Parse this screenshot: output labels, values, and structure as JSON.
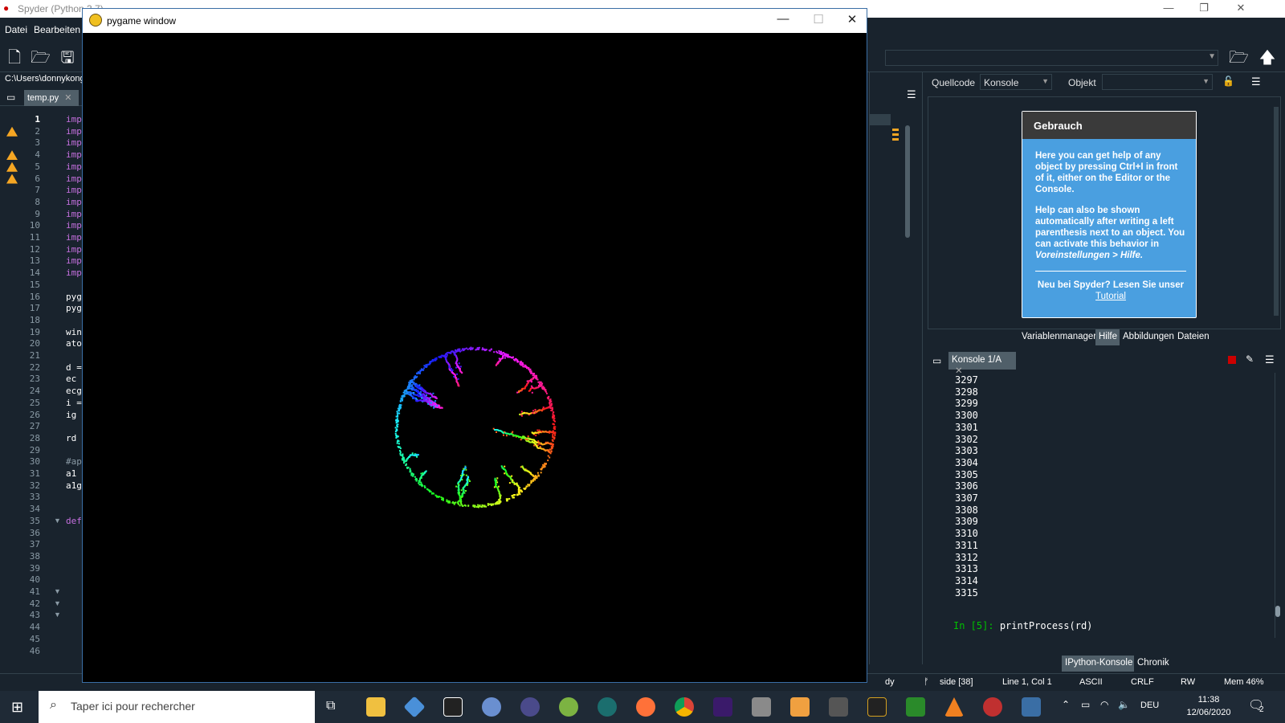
{
  "spyder": {
    "title": "Spyder (Python 3.7)",
    "menu": [
      "Datei",
      "Bearbeiten"
    ],
    "path": "C:\\Users\\donnykong",
    "editor_tab": "temp.py",
    "code_lines": [
      {
        "n": "1",
        "t": "imp"
      },
      {
        "n": "2",
        "t": "imp"
      },
      {
        "n": "3",
        "t": "imp"
      },
      {
        "n": "4",
        "t": "imp"
      },
      {
        "n": "5",
        "t": "imp"
      },
      {
        "n": "6",
        "t": "imp"
      },
      {
        "n": "7",
        "t": "imp"
      },
      {
        "n": "8",
        "t": "imp"
      },
      {
        "n": "9",
        "t": "imp"
      },
      {
        "n": "10",
        "t": "imp"
      },
      {
        "n": "11",
        "t": "imp"
      },
      {
        "n": "12",
        "t": "imp"
      },
      {
        "n": "13",
        "t": "imp"
      },
      {
        "n": "14",
        "t": "imp"
      },
      {
        "n": "15",
        "t": ""
      },
      {
        "n": "16",
        "t": "pyg"
      },
      {
        "n": "17",
        "t": "pyg"
      },
      {
        "n": "18",
        "t": ""
      },
      {
        "n": "19",
        "t": "win"
      },
      {
        "n": "20",
        "t": "ato"
      },
      {
        "n": "21",
        "t": ""
      },
      {
        "n": "22",
        "t": "d ="
      },
      {
        "n": "23",
        "t": "ec"
      },
      {
        "n": "24",
        "t": "ecg"
      },
      {
        "n": "25",
        "t": "i ="
      },
      {
        "n": "26",
        "t": "ig"
      },
      {
        "n": "27",
        "t": ""
      },
      {
        "n": "28",
        "t": "rd"
      },
      {
        "n": "29",
        "t": ""
      },
      {
        "n": "30",
        "t": "#ap"
      },
      {
        "n": "31",
        "t": "a1"
      },
      {
        "n": "32",
        "t": "a1g"
      },
      {
        "n": "33",
        "t": ""
      },
      {
        "n": "34",
        "t": ""
      },
      {
        "n": "35",
        "t": "def"
      },
      {
        "n": "36",
        "t": ""
      },
      {
        "n": "37",
        "t": ""
      },
      {
        "n": "38",
        "t": ""
      },
      {
        "n": "39",
        "t": ""
      },
      {
        "n": "40",
        "t": ""
      },
      {
        "n": "41",
        "t": ""
      },
      {
        "n": "42",
        "t": ""
      },
      {
        "n": "43",
        "t": ""
      },
      {
        "n": "44",
        "t": ""
      },
      {
        "n": "45",
        "t": ""
      },
      {
        "n": "46",
        "t": ""
      }
    ],
    "help": {
      "source_label": "Quellcode",
      "source_value": "Konsole",
      "object_label": "Objekt",
      "object_value": "",
      "box_title": "Gebrauch",
      "p1": "Here you can get help of any object by pressing Ctrl+I in front of it, either on the Editor or the Console.",
      "p2a": "Help can also be shown automatically after writing a left parenthesis next to an object. You can activate this behavior in ",
      "p2b": "Voreinstellungen > Hilfe.",
      "p3": "Neu bei Spyder? Lesen Sie unser",
      "p3link": "Tutorial"
    },
    "pane_tabs": [
      "Variablenmanager",
      "Hilfe",
      "Abbildungen",
      "Dateien"
    ],
    "console_tab": "Konsole 1/A",
    "console_lines": [
      "3297",
      "3298",
      "3299",
      "3300",
      "3301",
      "3302",
      "3303",
      "3304",
      "3305",
      "3306",
      "3307",
      "3308",
      "3309",
      "3310",
      "3311",
      "3312",
      "3313",
      "3314",
      "3315"
    ],
    "console_prompt": "In [5]:",
    "console_input": "printProcess(rd)",
    "bottom_tabs": [
      "IPython-Konsole",
      "Chronik"
    ],
    "status": {
      "ready": "dy",
      "branch": "side [38]",
      "pos": "Line 1, Col 1",
      "enc": "ASCII",
      "eol": "CRLF",
      "rw": "RW",
      "mem": "Mem 46%"
    }
  },
  "pygame": {
    "title": "pygame window"
  },
  "taskbar": {
    "search_placeholder": "Taper ici pour rechercher",
    "lang": "DEU",
    "time": "11:38",
    "date": "12/06/2020",
    "notif_count": "2"
  },
  "colors": {
    "bg": "#19232d",
    "help_box": "#4a9fe0",
    "warning": "#f5a623",
    "keyword": "#c670e0"
  }
}
